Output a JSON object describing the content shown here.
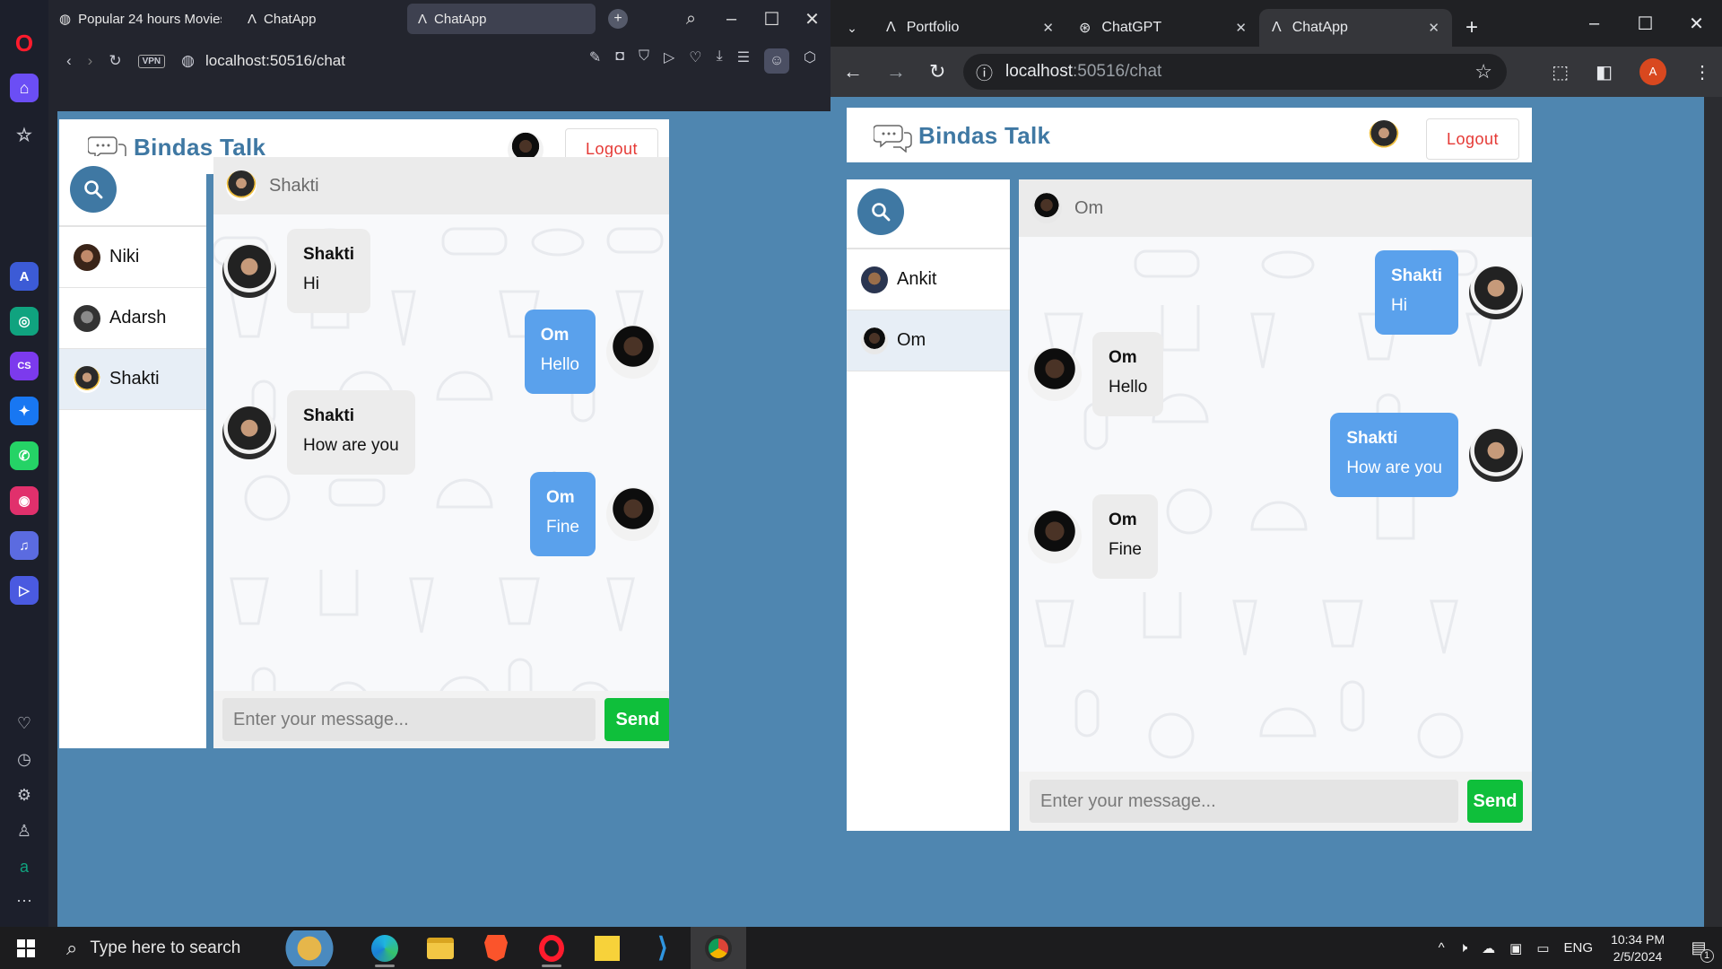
{
  "opera": {
    "tabs": [
      {
        "label": "Popular 24 hours Movies",
        "icon": "globe-icon"
      },
      {
        "label": "ChatApp",
        "icon": "angular-icon"
      },
      {
        "label": "ChatApp",
        "icon": "angular-icon"
      }
    ],
    "url": "localhost:50516/chat",
    "vpn": "VPN"
  },
  "chrome": {
    "tabs": [
      {
        "label": "Portfolio",
        "icon": "angular-icon"
      },
      {
        "label": "ChatGPT",
        "icon": "chatgpt-icon"
      },
      {
        "label": "ChatApp",
        "icon": "angular-icon"
      }
    ],
    "url_host": "localhost",
    "url_path": ":50516/chat",
    "profile_letter": "A"
  },
  "app": {
    "brand": "Bindas Talk",
    "logout_label": "Logout",
    "input_placeholder": "Enter your message...",
    "send_label": "Send"
  },
  "left_chat": {
    "contacts": [
      {
        "name": "Niki"
      },
      {
        "name": "Adarsh"
      },
      {
        "name": "Shakti"
      }
    ],
    "header_name": "Shakti",
    "messages": [
      {
        "sender": "Shakti",
        "text": "Hi",
        "side": "in"
      },
      {
        "sender": "Om",
        "text": "Hello",
        "side": "out"
      },
      {
        "sender": "Shakti",
        "text": "How are you",
        "side": "in"
      },
      {
        "sender": "Om",
        "text": "Fine",
        "side": "out"
      }
    ]
  },
  "right_chat": {
    "contacts": [
      {
        "name": "Ankit"
      },
      {
        "name": "Om"
      }
    ],
    "header_name": "Om",
    "messages": [
      {
        "sender": "Shakti",
        "text": "Hi",
        "side": "out"
      },
      {
        "sender": "Om",
        "text": "Hello",
        "side": "in"
      },
      {
        "sender": "Shakti",
        "text": "How are you",
        "side": "out"
      },
      {
        "sender": "Om",
        "text": "Fine",
        "side": "in"
      }
    ]
  },
  "taskbar": {
    "search_placeholder": "Type here to search",
    "language": "ENG",
    "time": "10:34 PM",
    "date": "2/5/2024",
    "notification_count": "1"
  }
}
